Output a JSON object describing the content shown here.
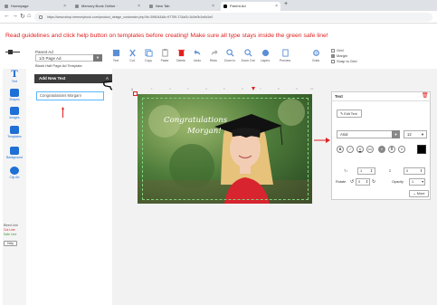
{
  "browser": {
    "tabs": [
      {
        "label": "Homepage",
        "active": false
      },
      {
        "label": "Memory Book Online ·",
        "active": false
      },
      {
        "label": "New Tab",
        "active": false
      },
      {
        "label": "Parent Ad",
        "active": true
      }
    ],
    "new_tab_label": "+",
    "nav": {
      "back": "←",
      "forward": "→",
      "reload": "↻",
      "home": "⌂"
    },
    "url": "https://www.shop.memorybook.com/product_design_customize.php?id=39604&&b=97759.17&id3=3c5e0b1e6d1e0"
  },
  "banner": "Read guidelines and click help button on templates before creating! Make sure all type stays inside the green safe line!",
  "toolbar": {
    "parent_label": "Parent Ad",
    "page_select_value": "1/2 Page Ad",
    "template_label": "Blank Half Page Ad Template",
    "tools": [
      {
        "label": "Text",
        "icon": "text-tool-icon"
      },
      {
        "label": "Cut",
        "icon": "scissors-icon"
      },
      {
        "label": "Copy",
        "icon": "copy-icon"
      },
      {
        "label": "Paste",
        "icon": "paste-icon"
      },
      {
        "label": "Delete",
        "icon": "delete-icon"
      },
      {
        "label": "Undo",
        "icon": "undo-icon"
      },
      {
        "label": "Redo",
        "icon": "redo-icon"
      },
      {
        "label": "Zoom In",
        "icon": "zoom-in-icon"
      },
      {
        "label": "Zoom Out",
        "icon": "zoom-out-icon"
      },
      {
        "label": "Layers",
        "icon": "layers-icon"
      },
      {
        "label": "Preview",
        "icon": "preview-icon"
      },
      {
        "label": "Grids",
        "icon": "grids-icon"
      }
    ],
    "checkboxes": [
      "Grid",
      "Margin",
      "Snap to Grid"
    ]
  },
  "sidebar": {
    "items": [
      {
        "label": "Text",
        "icon": "text-icon"
      },
      {
        "label": "Shapes",
        "icon": "shapes-icon"
      },
      {
        "label": "Images",
        "icon": "images-icon"
      },
      {
        "label": "Templates",
        "icon": "templates-icon"
      },
      {
        "label": "Background",
        "icon": "background-icon"
      },
      {
        "label": "Clip Art",
        "icon": "clip-art-icon"
      }
    ],
    "links": [
      "Bleed Line",
      "Cut Line",
      "Safe Line"
    ],
    "help_label": "Help"
  },
  "text_panel": {
    "header": "Add New Text",
    "count": "A",
    "entry_value": "Congratulations Morgan!"
  },
  "canvas": {
    "page_number": "1",
    "ruler_ticks": [
      "1",
      "2",
      "3",
      "4",
      "5",
      "6",
      "7",
      "8",
      "9",
      "10"
    ],
    "greeting_line1": "Congratulations",
    "greeting_line2": "Morgan!"
  },
  "properties": {
    "title": "Text",
    "edit_button": "Edit Text",
    "font_family": "Arial",
    "font_size": "12",
    "format_buttons": [
      "B",
      "I",
      "U",
      "UU",
      "≡",
      "≣",
      "≡"
    ],
    "spacing_label": "T↕",
    "spacing_value": "1",
    "kerning_label": "Σ",
    "kerning_value": "0",
    "rotate_label": "Rotate",
    "rotate_value": "0",
    "opacity_label": "Opacity",
    "opacity_value": "1",
    "more_label": "More",
    "text_color": "#000000"
  },
  "colors": {
    "banner": "#e02020",
    "sidebar_accent": "#1f6fd6",
    "safe_line": "#7dd37d",
    "delete": "#e02020"
  }
}
